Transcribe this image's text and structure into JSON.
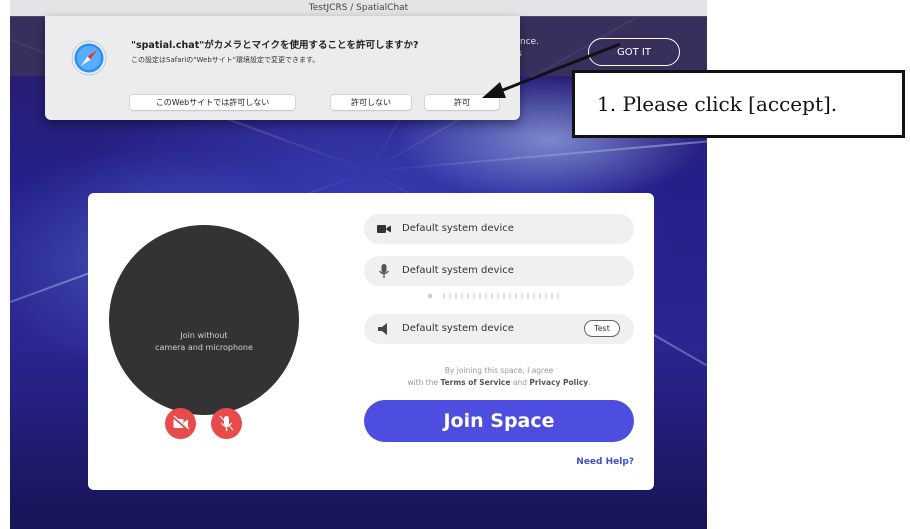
{
  "window": {
    "title": "TestJCRS / SpatialChat"
  },
  "banner": {
    "text": "perience.\ng this",
    "button": "GOT IT"
  },
  "dialog": {
    "title": "\"spatial.chat\"がカメラとマイクを使用することを許可しますか?",
    "subtitle": "この設定はSafariの\"Webサイト\"環境設定で変更できます。",
    "buttons": {
      "never": "このWebサイトでは許可しない",
      "deny": "許可しない",
      "allow": "許可"
    }
  },
  "join_card": {
    "preview_text_line1": "Join without",
    "preview_text_line2": "camera and microphone",
    "devices": {
      "camera": "Default system device",
      "microphone": "Default system device",
      "speaker": "Default system device"
    },
    "test_button": "Test",
    "agree_prefix": "By joining this space, I agree",
    "agree_with": "with the ",
    "terms": "Terms of Service",
    "and": " and ",
    "privacy": "Privacy Policy",
    "period": ".",
    "join_button": "Join Space",
    "help_link": "Need Help?"
  },
  "annotation": {
    "text": "1. Please click [accept]."
  },
  "colors": {
    "accent": "#4d4de0",
    "danger": "#e94b4b",
    "link": "#3d4fcf"
  },
  "icons": [
    "safari-icon",
    "video-camera-icon",
    "microphone-icon",
    "speaker-icon",
    "camera-off-icon",
    "mic-off-icon",
    "arrow-icon"
  ]
}
